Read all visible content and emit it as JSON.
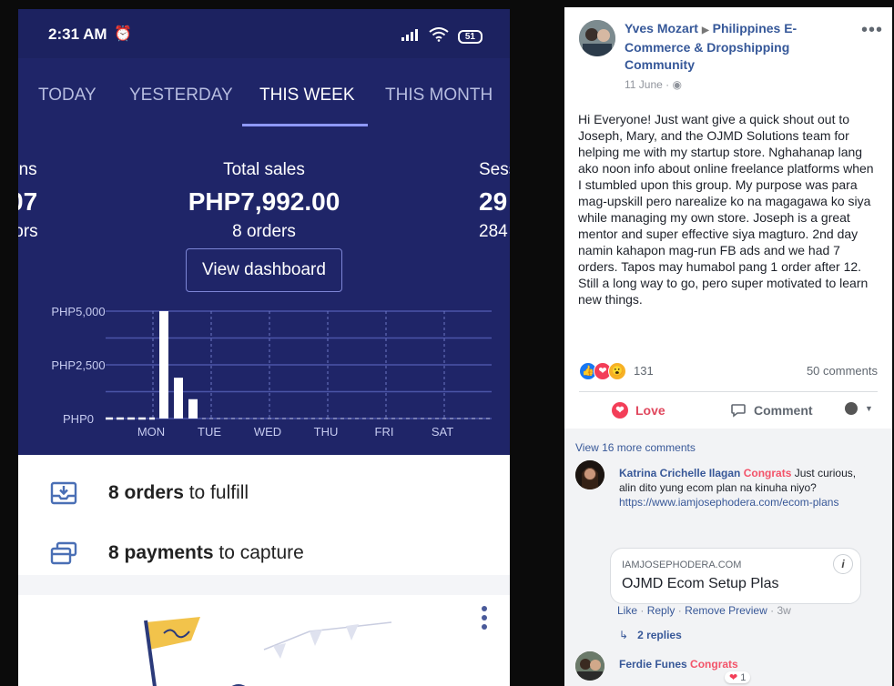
{
  "phone": {
    "status_time": "2:31 AM",
    "battery": "51",
    "tabs": [
      "TODAY",
      "YESTERDAY",
      "THIS WEEK",
      "THIS MONTH"
    ],
    "active_tab": "THIS WEEK",
    "metrics": {
      "left": {
        "title": "ons",
        "value": "07",
        "sub": "tors"
      },
      "center": {
        "title": "Total sales",
        "value": "PHP7,992.00",
        "sub": "8 orders"
      },
      "right": {
        "title": "Sess",
        "value": "29",
        "sub": "284"
      }
    },
    "dashboard_button": "View dashboard",
    "chart_data": {
      "type": "bar",
      "title": "",
      "y_ticks": [
        "PHP5,000",
        "PHP2,500",
        "PHP0"
      ],
      "ylim": [
        0,
        5000
      ],
      "x_labels": [
        "MON",
        "TUE",
        "WED",
        "THU",
        "FRI",
        "SAT"
      ],
      "bars": [
        5000,
        1900,
        900
      ]
    },
    "tasks": [
      {
        "bold": "8 orders",
        "rest": " to fulfill"
      },
      {
        "bold": "8 payments",
        "rest": " to capture"
      }
    ]
  },
  "fb": {
    "author": "Yves Mozart",
    "group": "Philippines E-Commerce & Dropshipping Community",
    "date": "11 June",
    "body": "Hi Everyone! Just want give a quick shout out to Joseph, Mary, and the OJMD Solutions team for helping me with my startup store. Nghahanap lang ako noon info about online freelance platforms when I stumbled upon this group. My purpose was para mag-upskill pero narealize ko na magagawa ko siya while managing my own store. Joseph is a great mentor and super effective siya magturo. 2nd day namin kahapon mag-run FB ads and we had 7 orders. Tapos may humabol pang 1 order after 12. Still a long way to go, pero super motivated to learn new things.",
    "reaction_count": "131",
    "comments_count": "50 comments",
    "love_label": "Love",
    "comment_label": "Comment",
    "view_more": "View 16 more comments",
    "comment1": {
      "name": "Katrina Crichelle Ilagan",
      "tag": "Congrats",
      "text": " Just curious, alin dito yung ecom plan na kinuha niyo?",
      "link": "https://www.iamjosephodera.com/ecom-plans",
      "preview_domain": "IAMJOSEPHODERA.COM",
      "preview_title": "OJMD Ecom Setup Plas",
      "like": "Like",
      "reply": "Reply",
      "remove": "Remove Preview",
      "time": "3w",
      "replies": "2 replies"
    },
    "comment2": {
      "name": "Ferdie Funes",
      "tag": "Congrats",
      "reaction_count": "1"
    }
  }
}
